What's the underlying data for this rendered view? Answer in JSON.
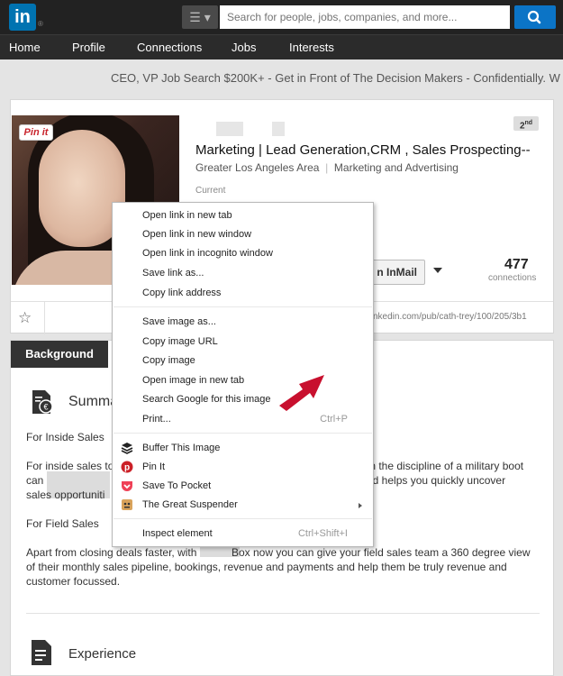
{
  "header": {
    "logo_text": "in",
    "logo_reg": "®",
    "search_placeholder": "Search for people, jobs, companies, and more...",
    "nav": [
      "Home",
      "Profile",
      "Connections",
      "Jobs",
      "Interests"
    ]
  },
  "ad_text": "CEO, VP Job Search $200K+ - Get in Front of The Decision Makers - Confidentially. W",
  "profile": {
    "pin_it": "Pin it",
    "degree": "2",
    "degree_suffix": "nd",
    "headline": "Marketing | Lead Generation,CRM , Sales Prospecting--",
    "location": "Greater Los Angeles Area",
    "industry": "Marketing and Advertising",
    "current_label": "Current",
    "inmail_label": "n InMail",
    "connections_count": "477",
    "connections_label": "connections",
    "public_url": "nkedin.com/pub/cath-trey/100/205/3b1"
  },
  "background": {
    "tab_label": "Background",
    "summary_title": "Summa",
    "lines": [
      "For Inside Sales",
      "For inside sales to",
      "th the discipline of a military boot",
      "can",
      "nd helps you quickly uncover",
      "sales opportuniti",
      "For Field Sales",
      "Apart from closing deals faster, with",
      "Box now you can give your field sales team a 360 degree view",
      "of their monthly sales pipeline, bookings, revenue and payments and help them be truly revenue and",
      "customer focussed."
    ],
    "experience_title": "Experience"
  },
  "context_menu": {
    "items": [
      {
        "label": "Open link in new tab"
      },
      {
        "label": "Open link in new window"
      },
      {
        "label": "Open link in incognito window"
      },
      {
        "label": "Save link as..."
      },
      {
        "label": "Copy link address"
      },
      {
        "label": "Save image as..."
      },
      {
        "label": "Copy image URL"
      },
      {
        "label": "Copy image"
      },
      {
        "label": "Open image in new tab"
      },
      {
        "label": "Search Google for this image"
      },
      {
        "label": "Print...",
        "shortcut": "Ctrl+P"
      },
      {
        "label": "Buffer This Image"
      },
      {
        "label": "Pin It"
      },
      {
        "label": "Save To Pocket"
      },
      {
        "label": "The Great Suspender"
      },
      {
        "label": "Inspect element",
        "shortcut": "Ctrl+Shift+I"
      }
    ]
  },
  "colors": {
    "linkedin_blue": "#0073b1",
    "search_blue": "#0b74c6",
    "arrow_red": "#c8102e"
  }
}
